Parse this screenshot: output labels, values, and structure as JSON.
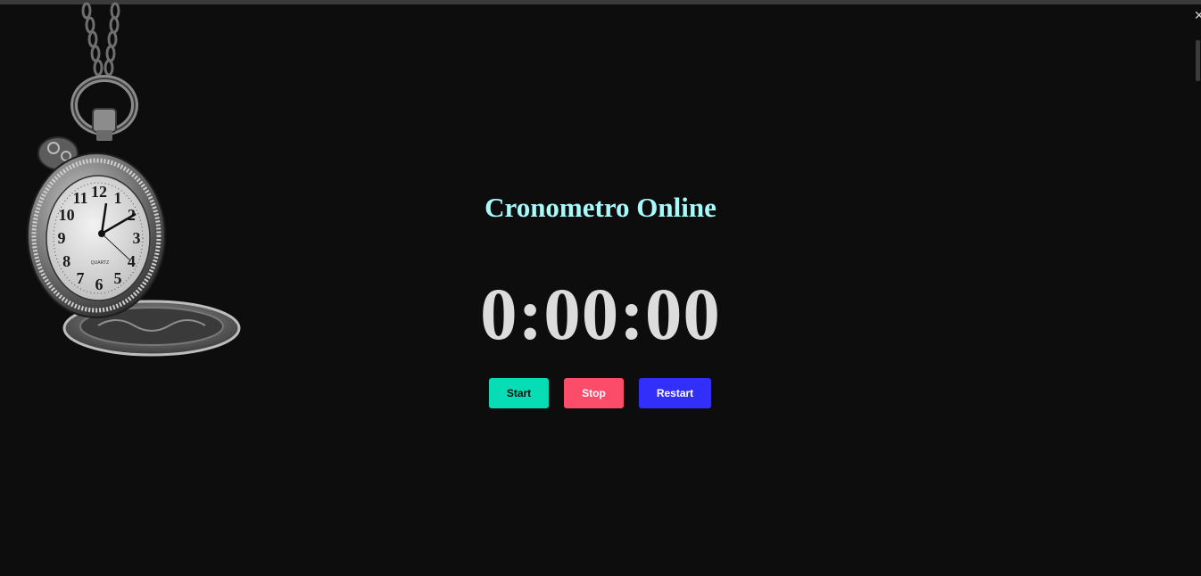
{
  "page": {
    "title": "Cronometro Online",
    "display": "0:00:00"
  },
  "controls": {
    "start_label": "Start",
    "stop_label": "Stop",
    "restart_label": "Restart"
  },
  "watch_dial": {
    "numerals": [
      "12",
      "1",
      "2",
      "3",
      "4",
      "5",
      "6",
      "7",
      "8",
      "9",
      "10",
      "11"
    ],
    "brand": "QUARTZ"
  },
  "colors": {
    "background": "#0d0d0d",
    "title": "#a6fbfb",
    "display": "#dcdcdc",
    "start": "#07ddb4",
    "stop": "#fb4d6a",
    "restart": "#332ffb"
  },
  "icons": {
    "decoration": "pocket-watch-icon"
  }
}
